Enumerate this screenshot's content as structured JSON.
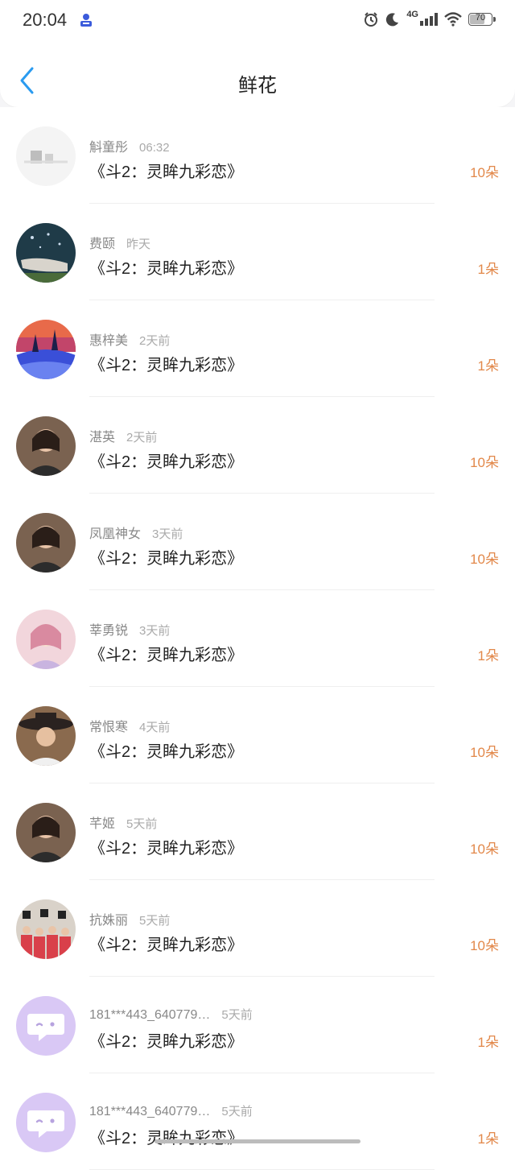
{
  "status_bar": {
    "time": "20:04",
    "network": "4G",
    "battery_level": "70",
    "battery_fraction": 0.7
  },
  "header": {
    "title": "鲜花"
  },
  "items": [
    {
      "name": "斛童彤",
      "time": "06:32",
      "book": "《斗2：灵眸九彩恋》",
      "count": "10朵",
      "avatar": "avatar-snow-icon"
    },
    {
      "name": "费颐",
      "time": "昨天",
      "book": "《斗2：灵眸九彩恋》",
      "count": "1朵",
      "avatar": "avatar-hand-icon"
    },
    {
      "name": "惠梓美",
      "time": "2天前",
      "book": "《斗2：灵眸九彩恋》",
      "count": "1朵",
      "avatar": "avatar-landscape-icon"
    },
    {
      "name": "湛英",
      "time": "2天前",
      "book": "《斗2：灵眸九彩恋》",
      "count": "10朵",
      "avatar": "avatar-portrait-icon"
    },
    {
      "name": "凤凰神女",
      "time": "3天前",
      "book": "《斗2：灵眸九彩恋》",
      "count": "10朵",
      "avatar": "avatar-portrait-icon"
    },
    {
      "name": "莘勇锐",
      "time": "3天前",
      "book": "《斗2：灵眸九彩恋》",
      "count": "1朵",
      "avatar": "avatar-anime-icon"
    },
    {
      "name": "常恨寒",
      "time": "4天前",
      "book": "《斗2：灵眸九彩恋》",
      "count": "10朵",
      "avatar": "avatar-hat-icon"
    },
    {
      "name": "芊姬",
      "time": "5天前",
      "book": "《斗2：灵眸九彩恋》",
      "count": "10朵",
      "avatar": "avatar-portrait-icon"
    },
    {
      "name": "抗姝丽",
      "time": "5天前",
      "book": "《斗2：灵眸九彩恋》",
      "count": "10朵",
      "avatar": "avatar-group-icon"
    },
    {
      "name": "181***443_640779…",
      "time": "5天前",
      "book": "《斗2：灵眸九彩恋》",
      "count": "1朵",
      "avatar": "default-chat-avatar-icon"
    },
    {
      "name": "181***443_640779…",
      "time": "5天前",
      "book": "《斗2：灵眸九彩恋》",
      "count": "1朵",
      "avatar": "default-chat-avatar-icon"
    }
  ],
  "colors": {
    "accent": "#2a9bf0",
    "count": "#e2884a",
    "default_avatar": "#d9c8f5"
  }
}
